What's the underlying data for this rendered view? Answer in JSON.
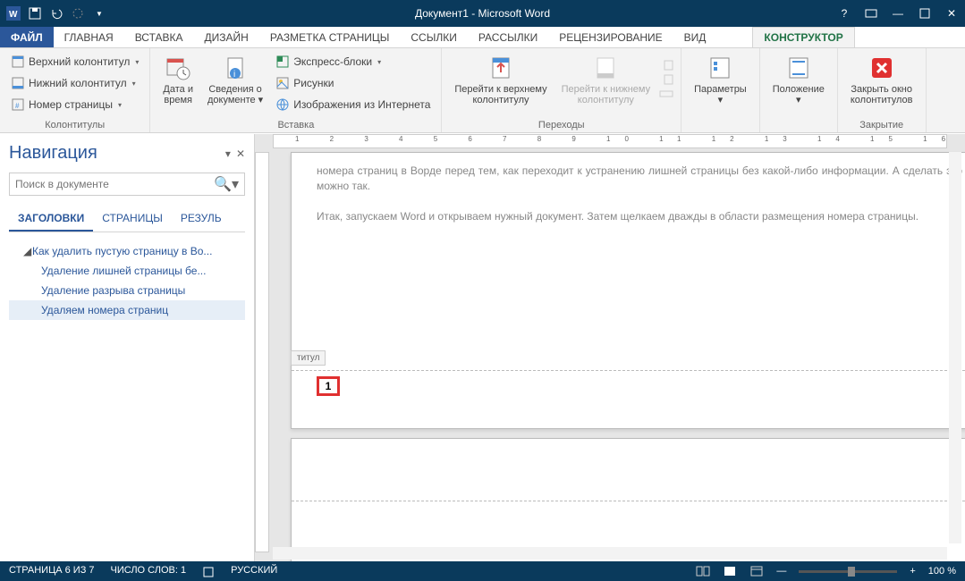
{
  "title": "Документ1 - Microsoft Word",
  "tabs": {
    "file": "ФАЙЛ",
    "items": [
      "ГЛАВНАЯ",
      "ВСТАВКА",
      "ДИЗАЙН",
      "РАЗМЕТКА СТРАНИЦЫ",
      "ССЫЛКИ",
      "РАССЫЛКИ",
      "РЕЦЕНЗИРОВАНИЕ",
      "ВИД"
    ],
    "context": "КОНСТРУКТОР"
  },
  "ribbon": {
    "kolontituly": {
      "header": "Верхний колонтитул",
      "footer": "Нижний колонтитул",
      "pagenum": "Номер страницы",
      "label": "Колонтитулы"
    },
    "vstavka": {
      "datetime": {
        "l1": "Дата и",
        "l2": "время"
      },
      "docinfo": {
        "l1": "Сведения о",
        "l2": "документе"
      },
      "express": "Экспресс-блоки",
      "pictures": "Рисунки",
      "webpictures": "Изображения из Интернета",
      "label": "Вставка"
    },
    "perehody": {
      "goheader": {
        "l1": "Перейти к верхнему",
        "l2": "колонтитулу"
      },
      "gofooter": {
        "l1": "Перейти к нижнему",
        "l2": "колонтитулу"
      },
      "label": "Переходы"
    },
    "params": "Параметры",
    "position": "Положение",
    "close": {
      "l1": "Закрыть окно",
      "l2": "колонтитулов",
      "label": "Закрытие"
    }
  },
  "nav": {
    "title": "Навигация",
    "search_placeholder": "Поиск в документе",
    "tabs": [
      "ЗАГОЛОВКИ",
      "СТРАНИЦЫ",
      "РЕЗУЛЬ"
    ],
    "tree": {
      "root": "Как удалить пустую страницу в Во...",
      "c1": "Удаление лишней страницы бе...",
      "c2": "Удаление разрыва страницы",
      "c3": "Удаляем номера страниц"
    }
  },
  "doc": {
    "p1": "номера страниц в Ворде перед тем, как переходит к устранению лишней страницы без какой-либо информации. А сделать это можно так.",
    "p2": "Итак, запускаем Word и открываем нужный документ. Затем щелкаем дважды в области размещения номера страницы.",
    "footer_label": "титул",
    "page_number": "1"
  },
  "status": {
    "page": "СТРАНИЦА 6 ИЗ 7",
    "words": "ЧИСЛО СЛОВ: 1",
    "lang": "РУССКИЙ",
    "zoom": "100 %"
  }
}
